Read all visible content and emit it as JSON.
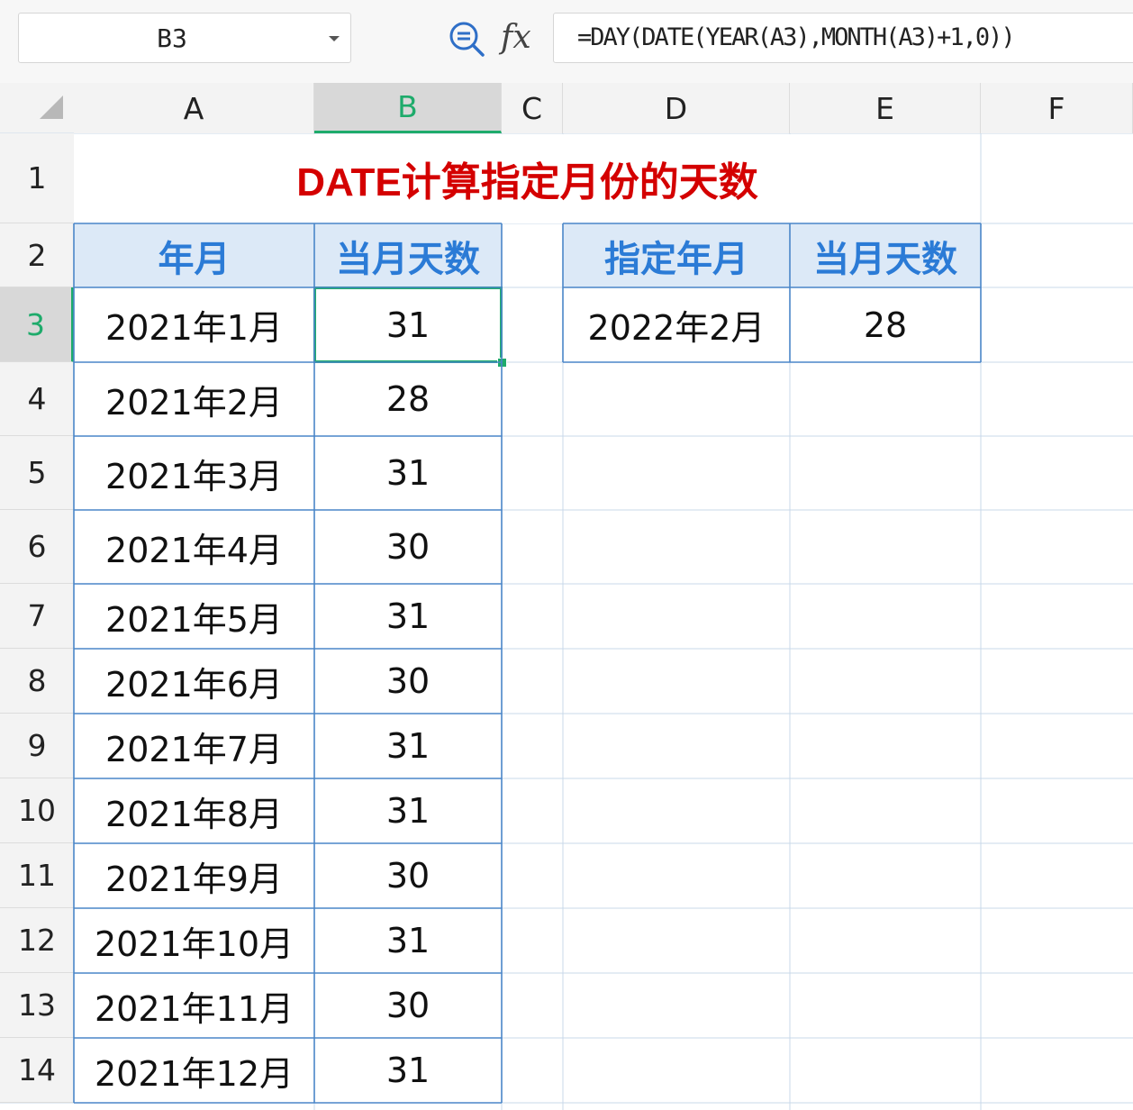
{
  "formula_bar": {
    "name_box": "B3",
    "zoom_icon": "zoom-formula-icon",
    "fx_label": "fx",
    "formula": "=DAY(DATE(YEAR(A3),MONTH(A3)+1,0))"
  },
  "grid": {
    "columns": [
      "A",
      "B",
      "C",
      "D",
      "E",
      "F"
    ],
    "rows": [
      "1",
      "2",
      "3",
      "4",
      "5",
      "6",
      "7",
      "8",
      "9",
      "10",
      "11",
      "12",
      "13",
      "14"
    ],
    "active_cell": "B3"
  },
  "sheet": {
    "title": "DATE计算指定月份的天数",
    "table1": {
      "headers": [
        "年月",
        "当月天数"
      ],
      "rows": [
        [
          "2021年1月",
          "31"
        ],
        [
          "2021年2月",
          "28"
        ],
        [
          "2021年3月",
          "31"
        ],
        [
          "2021年4月",
          "30"
        ],
        [
          "2021年5月",
          "31"
        ],
        [
          "2021年6月",
          "30"
        ],
        [
          "2021年7月",
          "31"
        ],
        [
          "2021年8月",
          "31"
        ],
        [
          "2021年9月",
          "30"
        ],
        [
          "2021年10月",
          "31"
        ],
        [
          "2021年11月",
          "30"
        ],
        [
          "2021年12月",
          "31"
        ]
      ]
    },
    "table2": {
      "headers": [
        "指定年月",
        "当月天数"
      ],
      "rows": [
        [
          "2022年2月",
          "28"
        ]
      ]
    }
  },
  "colors": {
    "accent_green": "#1eab6b",
    "title_red": "#d40000",
    "header_fill": "#dce9f7",
    "header_text": "#2b7bd6",
    "table_border": "#4a86c8"
  }
}
